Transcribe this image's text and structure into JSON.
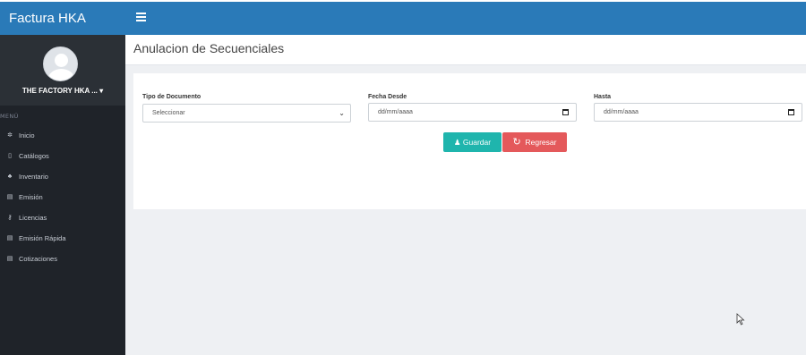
{
  "app": {
    "brand": "Factura HKA"
  },
  "sidebar": {
    "profile_name": "THE FACTORY HKA ... ▾",
    "menu_title": "MENÚ",
    "items": [
      {
        "label": "Inicio",
        "icon": "dashboard-icon"
      },
      {
        "label": "Catálogos",
        "icon": "book-icon"
      },
      {
        "label": "Inventario",
        "icon": "cubes-icon"
      },
      {
        "label": "Emisión",
        "icon": "file-icon"
      },
      {
        "label": "Licencias",
        "icon": "key-icon"
      },
      {
        "label": "Emisión Rápida",
        "icon": "file-icon"
      },
      {
        "label": "Cotizaciones",
        "icon": "file-icon"
      }
    ]
  },
  "page": {
    "title": "Anulacion de Secuenciales"
  },
  "form": {
    "doc_type": {
      "label": "Tipo de Documento",
      "value": "Seleccionar"
    },
    "date_from": {
      "label": "Fecha Desde",
      "placeholder": "dd/mm/aaaa"
    },
    "date_to": {
      "label": "Hasta",
      "placeholder": "dd/mm/aaaa"
    }
  },
  "buttons": {
    "save": "Guardar",
    "back": "Regresar"
  },
  "colors": {
    "topbar": "#2a7ab8",
    "sidebar": "#1f2329",
    "save": "#1fb5ad",
    "back": "#e4595b"
  }
}
